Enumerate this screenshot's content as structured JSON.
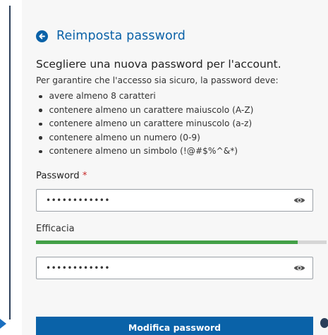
{
  "header": {
    "title": "Reimposta password",
    "back_icon": "arrow-left-circle-icon"
  },
  "subtitle": "Scegliere una nuova password per l'account.",
  "intro": "Per garantire che l'accesso sia sicuro, la password deve:",
  "requirements": [
    "avere almeno 8 caratteri",
    "contenere almeno un carattere maiuscolo (A-Z)",
    "contenere almeno un carattere minuscolo (a-z)",
    "contenere almeno un numero (0-9)",
    "contenere almeno un simbolo (!@#$%^&*)"
  ],
  "password_field": {
    "label": "Password",
    "required_marker": "*",
    "masked_value": "••••••••••••",
    "eye_icon": "eye-icon"
  },
  "strength": {
    "label": "Efficacia",
    "level_fraction": 0.9,
    "color": "#43a047"
  },
  "confirm_field": {
    "masked_value": "••••••••••••",
    "eye_icon": "eye-icon"
  },
  "submit": {
    "label": "Modifica password"
  },
  "colors": {
    "accent": "#0a62a8",
    "required": "#c62828",
    "meter_track": "#d6d6d6"
  }
}
